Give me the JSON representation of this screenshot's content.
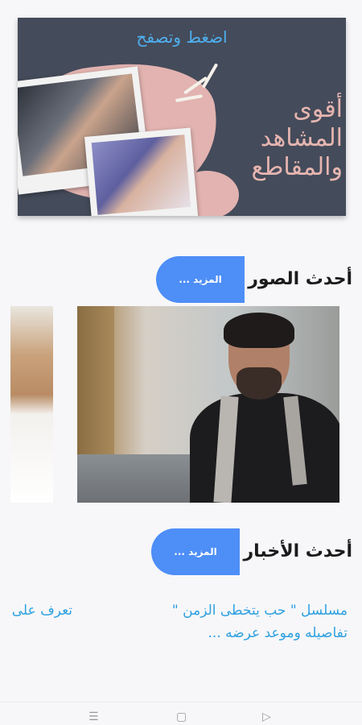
{
  "banner": {
    "cta": "اضغط وتصفح",
    "headline": [
      "أقوى",
      "المشاهد",
      "والمقاطع"
    ]
  },
  "sections": {
    "photos": {
      "title": "أحدث الصور",
      "more": "المزيد ..."
    },
    "news": {
      "title": "أحدث الأخبار",
      "more": "المزيد ..."
    }
  },
  "news_items": [
    {
      "text": "مسلسل \" حب يتخطى الزمن \" تفاصيله وموعد عرضه ..."
    },
    {
      "text": "تعرف على"
    }
  ],
  "navbar": {
    "menu_icon": "menu-icon",
    "home_icon": "home-square-icon",
    "back_icon": "back-triangle-icon"
  }
}
